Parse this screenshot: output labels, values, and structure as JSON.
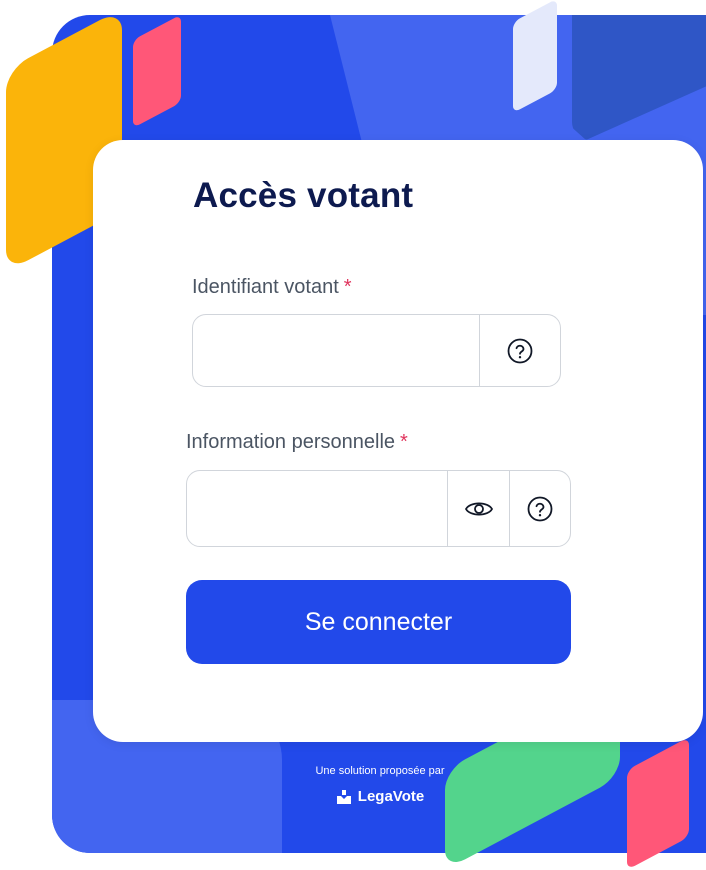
{
  "login": {
    "title": "Accès votant",
    "voter_id": {
      "label": "Identifiant votant",
      "required_mark": "*",
      "value": "",
      "placeholder": ""
    },
    "personal_info": {
      "label": "Information personnelle",
      "required_mark": "*",
      "value": "",
      "placeholder": ""
    },
    "submit_label": "Se connecter"
  },
  "footer": {
    "tagline": "Une solution proposée par",
    "brand": "LegaVote"
  },
  "icons": {
    "help": "question-circle-icon",
    "show_password": "eye-icon",
    "logo": "legavote-logo-icon"
  },
  "colors": {
    "primary": "#2249ea",
    "title": "#0d1a4f",
    "required": "#e0345d",
    "accent_yellow": "#fbb40a",
    "accent_pink": "#ff5778",
    "accent_green": "#53d48c"
  }
}
